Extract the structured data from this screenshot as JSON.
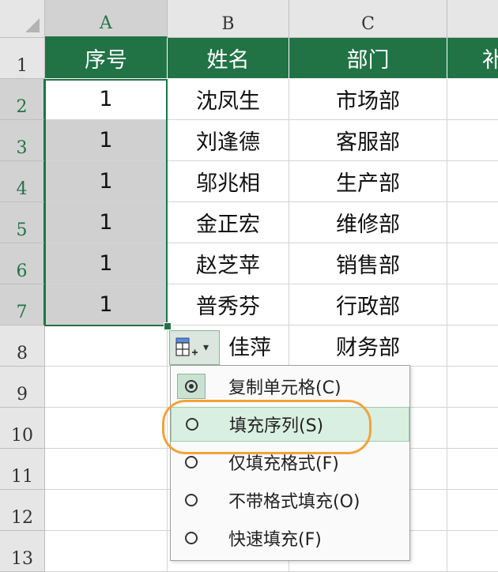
{
  "columns": [
    "A",
    "B",
    "C",
    ""
  ],
  "rows": [
    "1",
    "2",
    "3",
    "4",
    "5",
    "6",
    "7",
    "8",
    "9",
    "10",
    "11",
    "12",
    "13"
  ],
  "header_row": [
    "序号",
    "姓名",
    "部门",
    "补"
  ],
  "data_rows": [
    {
      "a": "1",
      "b": "沈凤生",
      "c": "市场部"
    },
    {
      "a": "1",
      "b": "刘逢德",
      "c": "客服部"
    },
    {
      "a": "1",
      "b": "邬兆相",
      "c": "生产部"
    },
    {
      "a": "1",
      "b": "金正宏",
      "c": "维修部"
    },
    {
      "a": "1",
      "b": "赵芝苹",
      "c": "销售部"
    },
    {
      "a": "1",
      "b": "普秀芬",
      "c": "行政部"
    },
    {
      "a": "",
      "b": "佳萍",
      "c": "财务部"
    }
  ],
  "autofill": {
    "icon": "autofill-options-icon",
    "chevron": "▾"
  },
  "menu": {
    "items": [
      {
        "label": "复制单元格(C)",
        "checked": true
      },
      {
        "label": "填充序列(S)",
        "checked": false,
        "highlighted": true
      },
      {
        "label": "仅填充格式(F)",
        "checked": false
      },
      {
        "label": "不带格式填充(O)",
        "checked": false
      },
      {
        "label": "快速填充(F)",
        "checked": false
      }
    ]
  },
  "colors": {
    "header_green": "#217346",
    "selection_gray": "#d0d0d0",
    "highlight_ring": "#f2a23a"
  }
}
